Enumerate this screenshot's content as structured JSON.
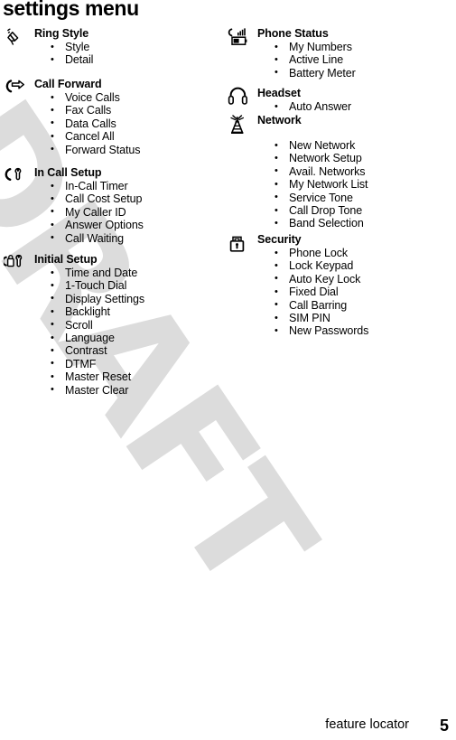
{
  "page": {
    "title": "settings menu",
    "footer_label": "feature locator",
    "footer_page_number": "5",
    "watermark_text": "DRAFT",
    "watermark_color": "#dcdcdc",
    "text_color": "#000000",
    "background_color": "#ffffff"
  },
  "columns": {
    "left": {
      "sections": [
        {
          "icon": "ring-style-bell-icon",
          "heading": "Ring Style",
          "items": [
            "Style",
            "Detail"
          ]
        },
        {
          "icon": "call-forward-handset-arrow-icon",
          "heading": "Call Forward",
          "items": [
            "Voice Calls",
            "Fax Calls",
            "Data Calls",
            "Cancel All",
            "Forward Status"
          ]
        },
        {
          "icon": "in-call-setup-handset-wrench-icon",
          "heading": "In Call Setup",
          "items": [
            "In-Call Timer",
            "Call Cost Setup",
            "My Caller ID",
            "Answer Options",
            "Call Waiting"
          ]
        },
        {
          "icon": "initial-setup-phone-wrench-icon",
          "heading": "Initial Setup",
          "items": [
            "Time and Date",
            "1-Touch Dial",
            "Display Settings",
            "Backlight",
            "Scroll",
            "Language",
            "Contrast",
            "DTMF",
            "Master Reset",
            "Master Clear"
          ]
        }
      ]
    },
    "right": {
      "sections": [
        {
          "icon": "phone-status-battery-signal-icon",
          "heading": "Phone Status",
          "items": [
            "My Numbers",
            "Active Line",
            "Battery Meter"
          ]
        },
        {
          "icon": "headset-headphones-icon",
          "heading": "Headset",
          "items": [
            "Auto Answer"
          ]
        },
        {
          "icon": "network-antenna-tower-icon",
          "heading": "Network",
          "items": [
            "New Network",
            "Network Setup",
            "Avail. Networks",
            "My Network List",
            "Service Tone",
            "Call Drop Tone",
            "Band Selection"
          ]
        },
        {
          "icon": "security-padlock-icon",
          "heading": "Security",
          "items": [
            "Phone Lock",
            "Lock Keypad",
            "Auto Key Lock",
            "Fixed Dial",
            "Call Barring",
            "SIM PIN",
            "New Passwords"
          ]
        }
      ]
    }
  }
}
